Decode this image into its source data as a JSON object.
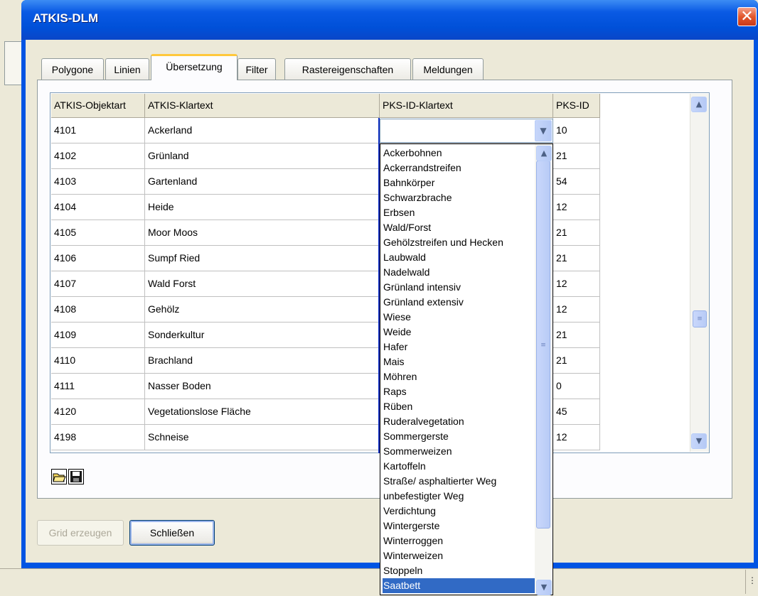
{
  "window": {
    "title": "ATKIS-DLM",
    "close_glyph": "✕"
  },
  "tabs": [
    {
      "label": "Polygone",
      "active": false
    },
    {
      "label": "Linien",
      "active": false
    },
    {
      "label": "Übersetzung",
      "active": true
    },
    {
      "label": "Filter",
      "active": false
    },
    {
      "label": "Rastereigenschaften",
      "active": false
    },
    {
      "label": "Meldungen",
      "active": false
    }
  ],
  "grid": {
    "columns": [
      "ATKIS-Objektart",
      "ATKIS-Klartext",
      "PKS-ID-Klartext",
      "PKS-ID"
    ],
    "rows": [
      [
        "4101",
        "Ackerland",
        "",
        "10"
      ],
      [
        "4102",
        "Grünland",
        "",
        "21"
      ],
      [
        "4103",
        "Gartenland",
        "",
        "54"
      ],
      [
        "4104",
        "Heide",
        "",
        "12"
      ],
      [
        "4105",
        "Moor Moos",
        "",
        "21"
      ],
      [
        "4106",
        "Sumpf Ried",
        "",
        "21"
      ],
      [
        "4107",
        "Wald Forst",
        "",
        "12"
      ],
      [
        "4108",
        "Gehölz",
        "",
        "12"
      ],
      [
        "4109",
        "Sonderkultur",
        "",
        "21"
      ],
      [
        "4110",
        "Brachland",
        "",
        "21"
      ],
      [
        "4111",
        "Nasser Boden",
        "",
        "0"
      ],
      [
        "4120",
        "Vegetationslose Fläche",
        "",
        "45"
      ],
      [
        "4198",
        "Schneise",
        "",
        "12"
      ]
    ]
  },
  "dropdown": {
    "options": [
      "Ackerbohnen",
      "Ackerrandstreifen",
      "Bahnkörper",
      "Schwarzbrache",
      "Erbsen",
      "Wald/Forst",
      "Gehölzstreifen und Hecken",
      "Laubwald",
      "Nadelwald",
      "Grünland intensiv",
      "Grünland extensiv",
      "Wiese",
      "Weide",
      "Hafer",
      "Mais",
      "Möhren",
      "Raps",
      "Rüben",
      "Ruderalvegetation",
      "Sommergerste",
      "Sommerweizen",
      "Kartoffeln",
      "Straße/ asphaltierter Weg",
      "unbefestigter Weg",
      "Verdichtung",
      "Wintergerste",
      "Winterroggen",
      "Winterweizen",
      "Stoppeln",
      "Saatbett"
    ],
    "selected": "Saatbett"
  },
  "toolbar": {
    "open_icon": "open-folder-icon",
    "save_icon": "save-disk-icon"
  },
  "buttons": {
    "grid": "Grid erzeugen",
    "close": "Schließen"
  },
  "colors": {
    "titlebar": "#0054e3",
    "selection": "#316ac5",
    "active_tab_accent": "#ffc83c",
    "close": "#e2572c"
  }
}
